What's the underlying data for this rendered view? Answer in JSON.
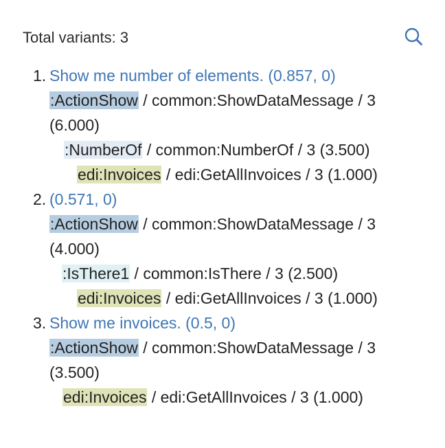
{
  "header": {
    "total_label": "Total variants: 3",
    "search_icon": "search-icon"
  },
  "colors": {
    "link": "#3f76b5",
    "action_tag": "#b6cde1",
    "number_tag": "#e3ebf5",
    "isthere_tag": "#dff1f4",
    "invoice_tag": "#dfe3b6"
  },
  "variants": [
    {
      "num": "1.",
      "title": "Show me number of elements. (0.857, 0)",
      "root": {
        "tag": ":ActionShow",
        "rest": " / common:ShowDataMessage / 3 (6.000)"
      },
      "child1": {
        "tag": ":NumberOf",
        "rest": " / common:NumberOf / 3 (3.500)"
      },
      "child2": {
        "tag": "edi:Invoices",
        "rest": " / edi:GetAllInvoices / 3 (1.000)"
      }
    },
    {
      "num": "2.",
      "title": "(0.571, 0)",
      "root": {
        "tag": ":ActionShow",
        "rest": " / common:ShowDataMessage / 3 (4.000)"
      },
      "child1": {
        "tag": ":IsThere1",
        "rest": " / common:IsThere / 3 (2.500)"
      },
      "child2": {
        "tag": "edi:Invoices",
        "rest": " / edi:GetAllInvoices / 3 (1.000)"
      }
    },
    {
      "num": "3.",
      "title": "Show me invoices. (0.5, 0)",
      "root": {
        "tag": ":ActionShow",
        "rest": " / common:ShowDataMessage / 3 (3.500)"
      },
      "child1": {
        "tag": "edi:Invoices",
        "rest": " / edi:GetAllInvoices / 3 (1.000)"
      }
    }
  ]
}
